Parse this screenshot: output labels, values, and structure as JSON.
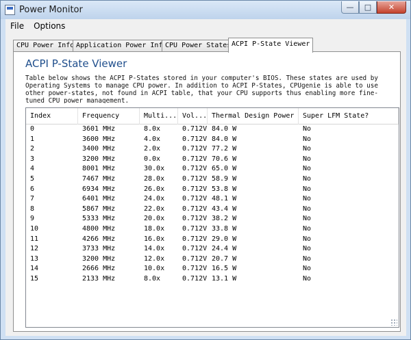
{
  "window": {
    "title": "Power Monitor"
  },
  "menu": {
    "items": [
      "File",
      "Options"
    ]
  },
  "tabs": [
    "CPU Power Info",
    "Application Power Info",
    "CPU Power States",
    "ACPI P-State Viewer"
  ],
  "active_tab": "ACPI P-State Viewer",
  "panel": {
    "title": "ACPI P-State Viewer",
    "description": "Table below shows the ACPI P-States stored in your computer's BIOS. These states are used by Operating Systems to manage CPU power. In addition to ACPI P-States, CPUgenie is able to use other power-states, not found in ACPI table, that your CPU supports thus enabling more fine-tuned CPU power management."
  },
  "table": {
    "headers": [
      "Index",
      "Frequency",
      "Multi...",
      "Vol...",
      "Thermal Design Power",
      "Super LFM State?"
    ],
    "rows": [
      [
        "0",
        "3601 MHz",
        "8.0x",
        "0.712V",
        "84.0 W",
        "No"
      ],
      [
        "1",
        "3600 MHz",
        "4.0x",
        "0.712V",
        "84.0 W",
        "No"
      ],
      [
        "2",
        "3400 MHz",
        "2.0x",
        "0.712V",
        "77.2 W",
        "No"
      ],
      [
        "3",
        "3200 MHz",
        "0.0x",
        "0.712V",
        "70.6 W",
        "No"
      ],
      [
        "4",
        "8001 MHz",
        "30.0x",
        "0.712V",
        "65.0 W",
        "No"
      ],
      [
        "5",
        "7467 MHz",
        "28.0x",
        "0.712V",
        "58.9 W",
        "No"
      ],
      [
        "6",
        "6934 MHz",
        "26.0x",
        "0.712V",
        "53.8 W",
        "No"
      ],
      [
        "7",
        "6401 MHz",
        "24.0x",
        "0.712V",
        "48.1 W",
        "No"
      ],
      [
        "8",
        "5867 MHz",
        "22.0x",
        "0.712V",
        "43.4 W",
        "No"
      ],
      [
        "9",
        "5333 MHz",
        "20.0x",
        "0.712V",
        "38.2 W",
        "No"
      ],
      [
        "10",
        "4800 MHz",
        "18.0x",
        "0.712V",
        "33.8 W",
        "No"
      ],
      [
        "11",
        "4266 MHz",
        "16.0x",
        "0.712V",
        "29.0 W",
        "No"
      ],
      [
        "12",
        "3733 MHz",
        "14.0x",
        "0.712V",
        "24.4 W",
        "No"
      ],
      [
        "13",
        "3200 MHz",
        "12.0x",
        "0.712V",
        "20.7 W",
        "No"
      ],
      [
        "14",
        "2666 MHz",
        "10.0x",
        "0.712V",
        "16.5 W",
        "No"
      ],
      [
        "15",
        "2133 MHz",
        "8.0x",
        "0.712V",
        "13.1 W",
        "No"
      ]
    ]
  },
  "icons": {
    "app": "app-window-icon",
    "minimize": "minimize-icon",
    "maximize": "maximize-icon",
    "close": "close-icon"
  }
}
